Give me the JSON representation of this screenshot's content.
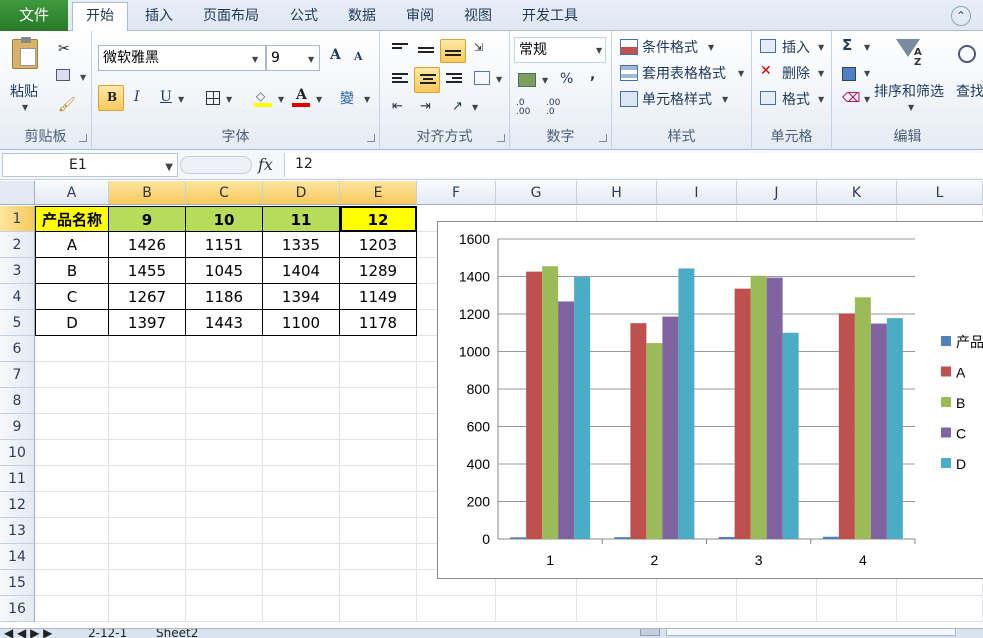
{
  "tabs": [
    {
      "label": "文件",
      "name": "tab-file"
    },
    {
      "label": "开始",
      "name": "tab-home"
    },
    {
      "label": "插入",
      "name": "tab-insert"
    },
    {
      "label": "页面布局",
      "name": "tab-page-layout"
    },
    {
      "label": "公式",
      "name": "tab-formulas"
    },
    {
      "label": "数据",
      "name": "tab-data"
    },
    {
      "label": "审阅",
      "name": "tab-review"
    },
    {
      "label": "视图",
      "name": "tab-view"
    },
    {
      "label": "开发工具",
      "name": "tab-developer"
    }
  ],
  "ribbon": {
    "clipboard": {
      "paste": "粘贴",
      "label": "剪贴板"
    },
    "font": {
      "name": "微软雅黑",
      "size": "9",
      "label": "字体",
      "bold": "B",
      "italic": "I",
      "underline": "U",
      "grow": "A",
      "shrink": "A",
      "font_color_glyph": "A",
      "phonetic": "變"
    },
    "alignment": {
      "label": "对齐方式"
    },
    "number": {
      "format": "常规",
      "label": "数字",
      "percent": "%",
      "comma": ",",
      "inc_decimal": ".0 .00",
      "dec_decimal": ".00 .0"
    },
    "styles": {
      "conditional": "条件格式",
      "table": "套用表格格式",
      "cell": "单元格样式",
      "label": "样式"
    },
    "cells": {
      "insert": "插入",
      "delete": "删除",
      "format": "格式",
      "label": "单元格"
    },
    "editing": {
      "sum": "Σ",
      "sort": "排序和筛选",
      "find": "查找",
      "label": "编辑"
    }
  },
  "formula_bar": {
    "name_box": "E1",
    "fx": "fx",
    "value": "12"
  },
  "columns": [
    "A",
    "B",
    "C",
    "D",
    "E",
    "F",
    "G",
    "H",
    "I",
    "J",
    "K",
    "L"
  ],
  "rows": [
    "1",
    "2",
    "3",
    "4",
    "5",
    "6",
    "7",
    "8",
    "9",
    "10",
    "11",
    "12",
    "13",
    "14",
    "15",
    "16"
  ],
  "table": {
    "header": [
      "产品名称",
      "9",
      "10",
      "11",
      "12"
    ],
    "rows": [
      [
        "A",
        "1426",
        "1151",
        "1335",
        "1203"
      ],
      [
        "B",
        "1455",
        "1045",
        "1404",
        "1289"
      ],
      [
        "C",
        "1267",
        "1186",
        "1394",
        "1149"
      ],
      [
        "D",
        "1397",
        "1443",
        "1100",
        "1178"
      ]
    ]
  },
  "colors": {
    "excel_green": "#2a7a29",
    "selection": "#f8c95b",
    "header_yellow": "#ffff00",
    "header_green": "#b7dc5a"
  },
  "chart_data": {
    "type": "bar",
    "categories": [
      "1",
      "2",
      "3",
      "4"
    ],
    "series": [
      {
        "name": "产品",
        "values": [
          9,
          10,
          11,
          12
        ],
        "color": "#4f81bd"
      },
      {
        "name": "A",
        "values": [
          1426,
          1151,
          1335,
          1203
        ],
        "color": "#c0504d"
      },
      {
        "name": "B",
        "values": [
          1455,
          1045,
          1404,
          1289
        ],
        "color": "#9bbb59"
      },
      {
        "name": "C",
        "values": [
          1267,
          1186,
          1394,
          1149
        ],
        "color": "#8064a2"
      },
      {
        "name": "D",
        "values": [
          1397,
          1443,
          1100,
          1178
        ],
        "color": "#4bacc6"
      }
    ],
    "yticks": [
      "0",
      "200",
      "400",
      "600",
      "800",
      "1000",
      "1200",
      "1400",
      "1600"
    ],
    "ylim": [
      0,
      1600
    ],
    "grid": true,
    "legend": "right"
  },
  "sheet_tabs": [
    "2-12-1",
    "Sheet2"
  ]
}
